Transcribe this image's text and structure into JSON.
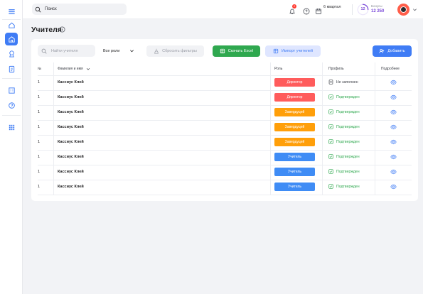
{
  "topbar": {
    "search_placeholder": "Поиск",
    "notifications_count": "2",
    "quarter_label": "6 квартал",
    "bonus_progress": "12",
    "bonus_label": "Бонусы",
    "bonus_value": "12 250"
  },
  "page": {
    "title": "Учителя"
  },
  "filters": {
    "search_placeholder": "Найти учителя",
    "roles_selected": "Все роли",
    "reset_label": "Сбросить фильтры",
    "excel_label": "Скачать Excel",
    "import_label": "Импорт учителей",
    "add_label": "Добавить"
  },
  "table": {
    "headers": {
      "number": "№",
      "name": "Фамилия и имя",
      "role": "Роль",
      "profile": "Профиль",
      "details": "Подробнее"
    },
    "rows": [
      {
        "num": "1",
        "name": "Кассиус Клей",
        "role": "Директор",
        "role_color": "#ff5c5c",
        "profile": "Не заполнен",
        "profile_color": "#3a3d44"
      },
      {
        "num": "1",
        "name": "Кассиус Клей",
        "role": "Директор",
        "role_color": "#ff5c5c",
        "profile": "Подтвержден",
        "profile_color": "#2fa84f"
      },
      {
        "num": "1",
        "name": "Кассиус Клей",
        "role": "Завердуцей",
        "role_color": "#ff9f0a",
        "profile": "Подтвержден",
        "profile_color": "#2fa84f"
      },
      {
        "num": "1",
        "name": "Кассиус Клей",
        "role": "Завердуцей",
        "role_color": "#ff9f0a",
        "profile": "Подтвержден",
        "profile_color": "#2fa84f"
      },
      {
        "num": "1",
        "name": "Кассиус Клей",
        "role": "Завердуцей",
        "role_color": "#ff9f0a",
        "profile": "Подтвержден",
        "profile_color": "#2fa84f"
      },
      {
        "num": "1",
        "name": "Кассиус Клей",
        "role": "Учитель",
        "role_color": "#3f8cf5",
        "profile": "Подтвержден",
        "profile_color": "#2fa84f"
      },
      {
        "num": "1",
        "name": "Кассиус Клей",
        "role": "Учитель",
        "role_color": "#3f8cf5",
        "profile": "Подтвержден",
        "profile_color": "#2fa84f"
      },
      {
        "num": "1",
        "name": "Кассиус Клей",
        "role": "Учитель",
        "role_color": "#3f8cf5",
        "profile": "Подтвержден",
        "profile_color": "#2fa84f"
      }
    ]
  },
  "colors": {
    "accent": "#3f7cf5",
    "success": "#2fa84f",
    "danger": "#ff5c5c",
    "warning": "#ff9f0a",
    "bonus": "#7b4ad8"
  }
}
